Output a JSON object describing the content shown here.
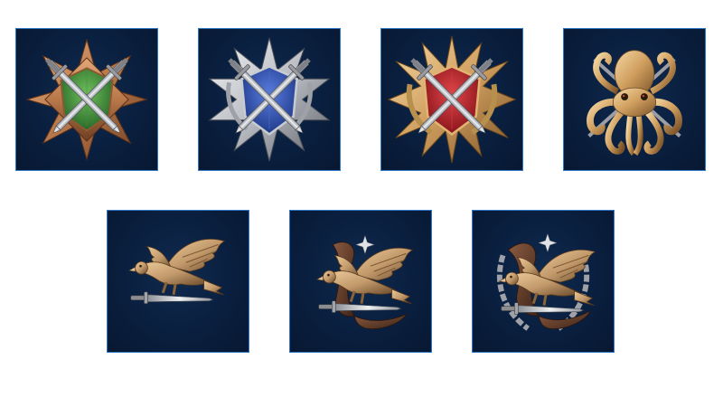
{
  "medals": [
    {
      "id": "swords-bronze",
      "icon": "crossed-swords-bronze-star-icon",
      "metal": "#b8784a",
      "shield": "#2e7a32"
    },
    {
      "id": "swords-silver",
      "icon": "crossed-swords-silver-star-icon",
      "metal": "#b9bcc2",
      "shield": "#2f4fb0"
    },
    {
      "id": "swords-gold",
      "icon": "crossed-swords-gold-star-icon",
      "metal": "#d0a060",
      "shield": "#b5141c"
    },
    {
      "id": "kraken",
      "icon": "kraken-octopus-icon",
      "metal": "#c9a071"
    },
    {
      "id": "eagle-dagger",
      "icon": "eagle-dagger-icon",
      "metal": "#c29a6c"
    },
    {
      "id": "eagle-ribbon",
      "icon": "eagle-ribbon-star-icon",
      "metal": "#c29a6c"
    },
    {
      "id": "eagle-wreath",
      "icon": "eagle-wreath-star-icon",
      "metal": "#c29a6c"
    }
  ],
  "colors": {
    "tile_background": "#0a1f3f",
    "tile_border": "#2f78c8",
    "page_background": "#ffffff"
  }
}
